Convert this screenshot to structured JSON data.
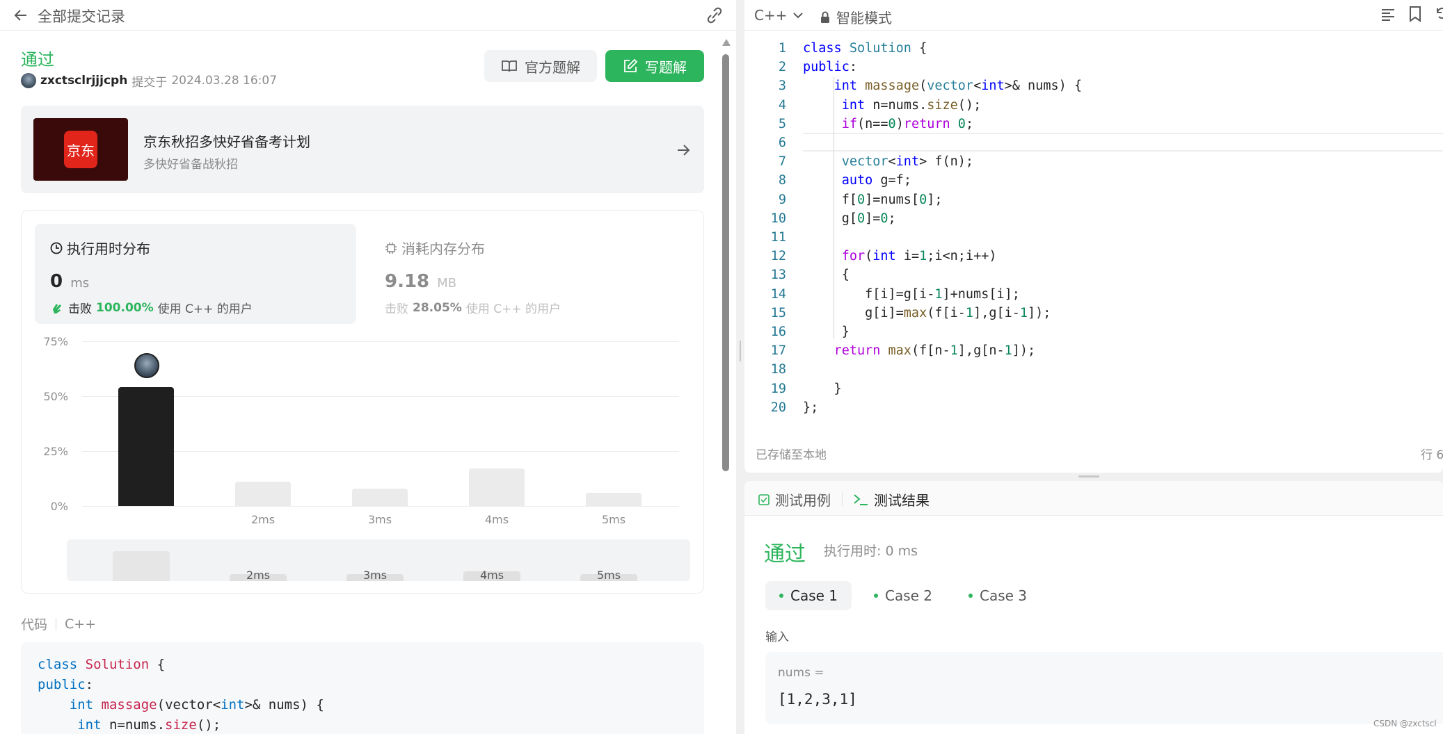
{
  "colors": {
    "accent_green": "#2db55d",
    "chart_bar_active": "#1f1f1f",
    "chart_bar": "#ebebeb"
  },
  "left": {
    "topbar": {
      "back_icon": "arrow-left-icon",
      "title": "全部提交记录",
      "link_icon": "link-icon"
    },
    "status": "通过",
    "user": {
      "name": "zxctsclrjjjcph",
      "submitted_prefix": "提交于",
      "submitted_at": "2024.03.28 16:07"
    },
    "buttons": {
      "official": "官方题解",
      "write": "写题解"
    },
    "ad": {
      "logo_text": "京东",
      "title": "京东秋招多快好省备考计划",
      "subtitle": "多快好省备战秋招"
    },
    "stats": {
      "runtime": {
        "title": "执行用时分布",
        "value": "0",
        "unit": "ms",
        "beat_prefix": "击败",
        "beat_pct": "100.00%",
        "beat_suffix": "使用 C++ 的用户"
      },
      "memory": {
        "title": "消耗内存分布",
        "value": "9.18",
        "unit": "MB",
        "beat_prefix": "击败",
        "beat_pct": "28.05%",
        "beat_suffix": "使用 C++ 的用户"
      }
    },
    "code_header": {
      "label": "代码",
      "lang": "C++"
    },
    "code_preview": [
      "class Solution {",
      "public:",
      "    int massage(vector<int>& nums) {",
      "     int n=nums.size();"
    ]
  },
  "chart_data": {
    "type": "bar",
    "categories": [
      "",
      "2ms",
      "3ms",
      "4ms",
      "5ms"
    ],
    "values": [
      54,
      11,
      8,
      17,
      6
    ],
    "yticks": [
      "75%",
      "50%",
      "25%",
      "0%"
    ],
    "ylim": [
      0,
      75
    ],
    "grid": true,
    "active_index": 0,
    "minimap": {
      "categories": [
        "",
        "2ms",
        "3ms",
        "4ms",
        "5ms"
      ],
      "values": [
        54,
        11,
        8,
        17,
        6
      ]
    }
  },
  "right": {
    "toolbar": {
      "lang": "C++",
      "mode": "智能模式"
    },
    "code": [
      "class Solution {",
      "public:",
      "    int massage(vector<int>& nums) {",
      "     int n=nums.size();",
      "     if(n==0)return 0;",
      "",
      "     vector<int> f(n);",
      "     auto g=f;",
      "     f[0]=nums[0];",
      "     g[0]=0;",
      "",
      "     for(int i=1;i<n;i++)",
      "     {",
      "        f[i]=g[i-1]+nums[i];",
      "        g[i]=max(f[i-1],g[i-1]);",
      "     }",
      "    return max(f[n-1],g[n-1]);",
      "",
      "    }",
      "};"
    ],
    "footer": {
      "saved": "已存储至本地",
      "pos": "行 6"
    },
    "tabs": {
      "testcase": "测试用例",
      "result": "测试结果"
    },
    "result": {
      "status": "通过",
      "runtime": "执行用时: 0 ms"
    },
    "cases": [
      "Case 1",
      "Case 2",
      "Case 3"
    ],
    "input_label": "输入",
    "input_var": "nums =",
    "input_value": "[1,2,3,1]",
    "watermark": "CSDN @zxctscl"
  }
}
